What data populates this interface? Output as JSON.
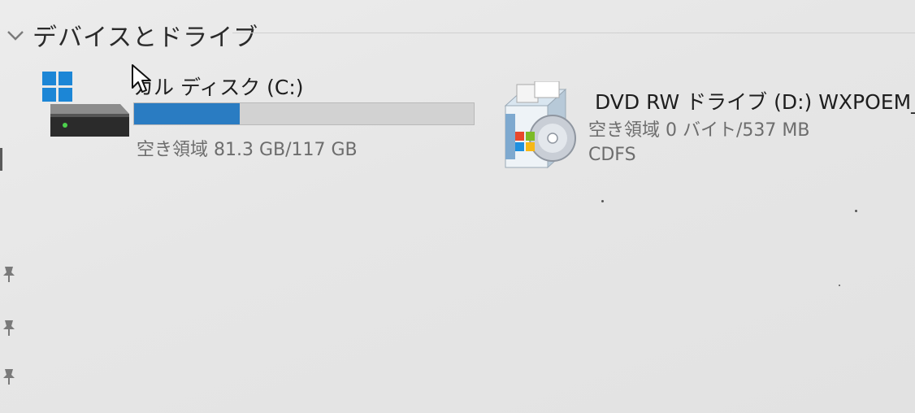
{
  "section": {
    "title": "デバイスとドライブ",
    "collapse_icon": "chevron-down-icon"
  },
  "drives": [
    {
      "id": "c",
      "name": "カル ディスク (C:)",
      "icon": "windows-drive-icon",
      "free_space_text": "空き領域 81.3 GB/117 GB",
      "used_fraction": 0.31,
      "bar_color": "#2a7cc2"
    },
    {
      "id": "d",
      "name": "DVD RW ドライブ (D:) WXPOEM_JA",
      "icon": "dvd-setup-icon",
      "free_space_text": "空き領域 0 バイト/537 MB",
      "filesystem": "CDFS"
    }
  ],
  "cursor": "arrow-cursor-icon",
  "sidebar_icons": [
    "pin-icon",
    "pin-icon",
    "pin-icon"
  ]
}
